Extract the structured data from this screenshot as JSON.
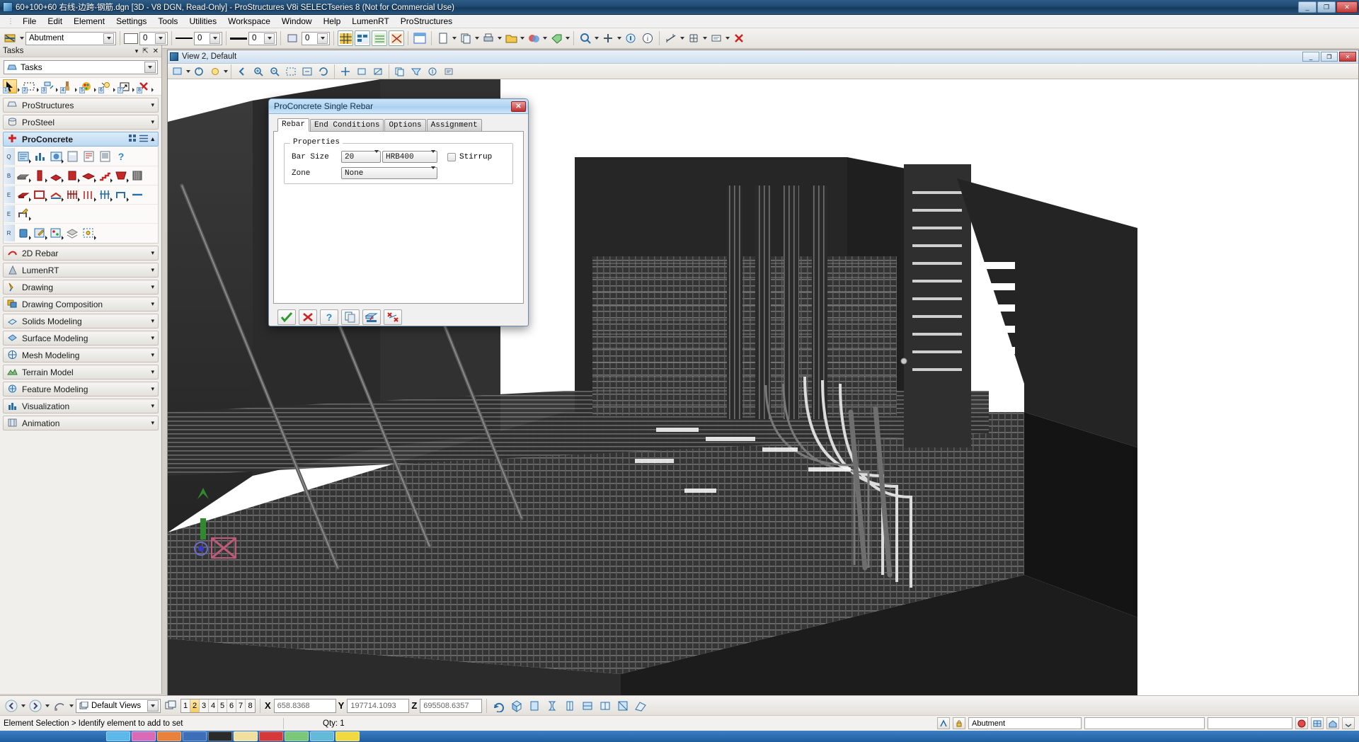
{
  "window": {
    "title": "60+100+60 右线-边跨-钢筋.dgn [3D - V8 DGN, Read-Only] - ProStructures V8i SELECTseries 8 (Not for Commercial Use)",
    "minimize_label": "_",
    "maximize_label": "❐",
    "close_label": "✕",
    "app_icon": "prostructures-icon"
  },
  "menu": {
    "items": [
      {
        "label": "File"
      },
      {
        "label": "Edit"
      },
      {
        "label": "Element"
      },
      {
        "label": "Settings"
      },
      {
        "label": "Tools"
      },
      {
        "label": "Utilities"
      },
      {
        "label": "Workspace"
      },
      {
        "label": "Window"
      },
      {
        "label": "Help"
      },
      {
        "label": "LumenRT"
      },
      {
        "label": "ProStructures"
      }
    ]
  },
  "toolbar": {
    "level_value": "Abutment",
    "color_value": "0",
    "style_value": "0",
    "weight_value": "0",
    "class_value": "0"
  },
  "tasks": {
    "panel_title": "Tasks",
    "tree_root": "Tasks",
    "pin_icon": "pin-icon",
    "close_icon": "close-icon",
    "chevron_icon": "chevron-down-icon",
    "quick_tools": [
      {
        "num": "1",
        "name": "element-selection-tool"
      },
      {
        "num": "2",
        "name": "fence-tool"
      },
      {
        "num": "3",
        "name": "manipulate-tool"
      },
      {
        "num": "4",
        "name": "change-attributes-tool"
      },
      {
        "num": "5",
        "name": "palette-tool"
      },
      {
        "num": "6",
        "name": "measure-tool"
      },
      {
        "num": "7",
        "name": "groups-tool"
      },
      {
        "num": "8",
        "name": "delete-element-tool"
      }
    ],
    "groups": [
      {
        "label": "ProStructures",
        "icon": "prostructures-icon",
        "active": false
      },
      {
        "label": "ProSteel",
        "icon": "prosteel-icon",
        "active": false
      },
      {
        "label": "ProConcrete",
        "icon": "proconcrete-icon",
        "active": true
      },
      {
        "label": "2D Rebar",
        "icon": "2d-rebar-icon",
        "active": false
      },
      {
        "label": "LumenRT",
        "icon": "lumenrt-icon",
        "active": false
      },
      {
        "label": "Drawing",
        "icon": "drawing-icon",
        "active": false
      },
      {
        "label": "Drawing Composition",
        "icon": "drawing-composition-icon",
        "active": false
      },
      {
        "label": "Solids Modeling",
        "icon": "solids-modeling-icon",
        "active": false
      },
      {
        "label": "Surface Modeling",
        "icon": "surface-modeling-icon",
        "active": false
      },
      {
        "label": "Mesh Modeling",
        "icon": "mesh-modeling-icon",
        "active": false
      },
      {
        "label": "Terrain Model",
        "icon": "terrain-model-icon",
        "active": false
      },
      {
        "label": "Feature Modeling",
        "icon": "feature-modeling-icon",
        "active": false
      },
      {
        "label": "Visualization",
        "icon": "visualization-icon",
        "active": false
      },
      {
        "label": "Animation",
        "icon": "animation-icon",
        "active": false
      }
    ],
    "proconcrete_view_icons": [
      "grid-view-icon",
      "list-view-icon",
      "chevron-up-icon"
    ],
    "proconcrete_rows": [
      {
        "gutter": "Q",
        "count": 7
      },
      {
        "gutter": "B",
        "count": 8
      },
      {
        "gutter": "E",
        "count": 8
      },
      {
        "gutter": "E",
        "count": 1
      },
      {
        "gutter": "R",
        "count": 5
      }
    ]
  },
  "view_window": {
    "title": "View 2, Default",
    "minimize_label": "_",
    "maximize_label": "❐",
    "close_label": "✕"
  },
  "dialog": {
    "title": "ProConcrete Single Rebar",
    "close_label": "✕",
    "tabs": [
      {
        "label": "Rebar",
        "selected": true
      },
      {
        "label": "End Conditions",
        "selected": false
      },
      {
        "label": "Options",
        "selected": false
      },
      {
        "label": "Assignment",
        "selected": false
      }
    ],
    "group_label": "Properties",
    "fields": {
      "bar_size_label": "Bar Size",
      "bar_size_value": "20",
      "grade_value": "HRB400",
      "zone_label": "Zone",
      "zone_value": "None",
      "stirrup_label": "Stirrup",
      "stirrup_checked": false
    },
    "buttons": [
      {
        "name": "apply-button",
        "icon": "green-check-icon"
      },
      {
        "name": "cancel-button",
        "icon": "red-x-icon"
      },
      {
        "name": "help-button",
        "icon": "blue-question-icon"
      },
      {
        "name": "copy-button",
        "icon": "copy-icon"
      },
      {
        "name": "place-on-solid-button",
        "icon": "solid-rebar-icon"
      },
      {
        "name": "points-button",
        "icon": "points-icon"
      }
    ]
  },
  "status_bar": {
    "back_icon": "back-arrow-icon",
    "forward_icon": "forward-arrow-icon",
    "view_rotate_icon": "view-rotate-icon",
    "views_value": "Default Views",
    "view_numbers": [
      "1",
      "2",
      "3",
      "4",
      "5",
      "6",
      "7",
      "8"
    ],
    "active_view": "2",
    "coords": [
      {
        "axis": "X",
        "value": "658.8368"
      },
      {
        "axis": "Y",
        "value": "197714.1093"
      },
      {
        "axis": "Z",
        "value": "695508.6357"
      }
    ],
    "message": "Element Selection > Identify element to add to set",
    "qty_label": "Qty: 1",
    "level_value": "Abutment",
    "lock_icon": "lock-icon",
    "snap_icon": "snap-icon"
  }
}
